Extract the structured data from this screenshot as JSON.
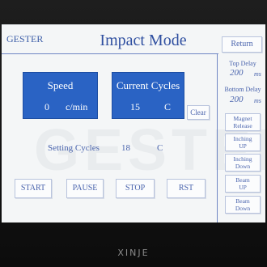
{
  "header": {
    "brand": "GESTER",
    "title": "Impact Mode",
    "return_label": "Return"
  },
  "speed": {
    "title": "Speed",
    "value": "0",
    "unit": "c/min"
  },
  "current_cycles": {
    "title": "Current Cycles",
    "value": "15",
    "unit": "C",
    "clear_label": "Clear"
  },
  "setting_cycles": {
    "label": "Setting Cycles",
    "value": "18",
    "unit": "C"
  },
  "controls": {
    "start": "START",
    "pause": "PAUSE",
    "stop": "STOP",
    "rst": "RST"
  },
  "side": {
    "top_delay_label": "Top Delay",
    "top_delay_value": "200",
    "top_delay_unit": "ms",
    "bottom_delay_label": "Bottom Delay",
    "bottom_delay_value": "200",
    "bottom_delay_unit": "ms",
    "magnet_line1": "Magnet",
    "magnet_line2": "Release",
    "inch_up_line1": "Inching",
    "inch_up_line2": "UP",
    "inch_down_line1": "Inching",
    "inch_down_line2": "Down",
    "beam_up_line1": "Beam",
    "beam_up_line2": "UP",
    "beam_down_line1": "Beam",
    "beam_down_line2": "Down"
  },
  "watermark": "GESTER",
  "device_brand": "XINJE",
  "colors": {
    "panel_blue": "#2a63c4",
    "text_blue": "#4a64ad",
    "screen_bg": "#f4f6f7",
    "bezel": "#141414"
  }
}
